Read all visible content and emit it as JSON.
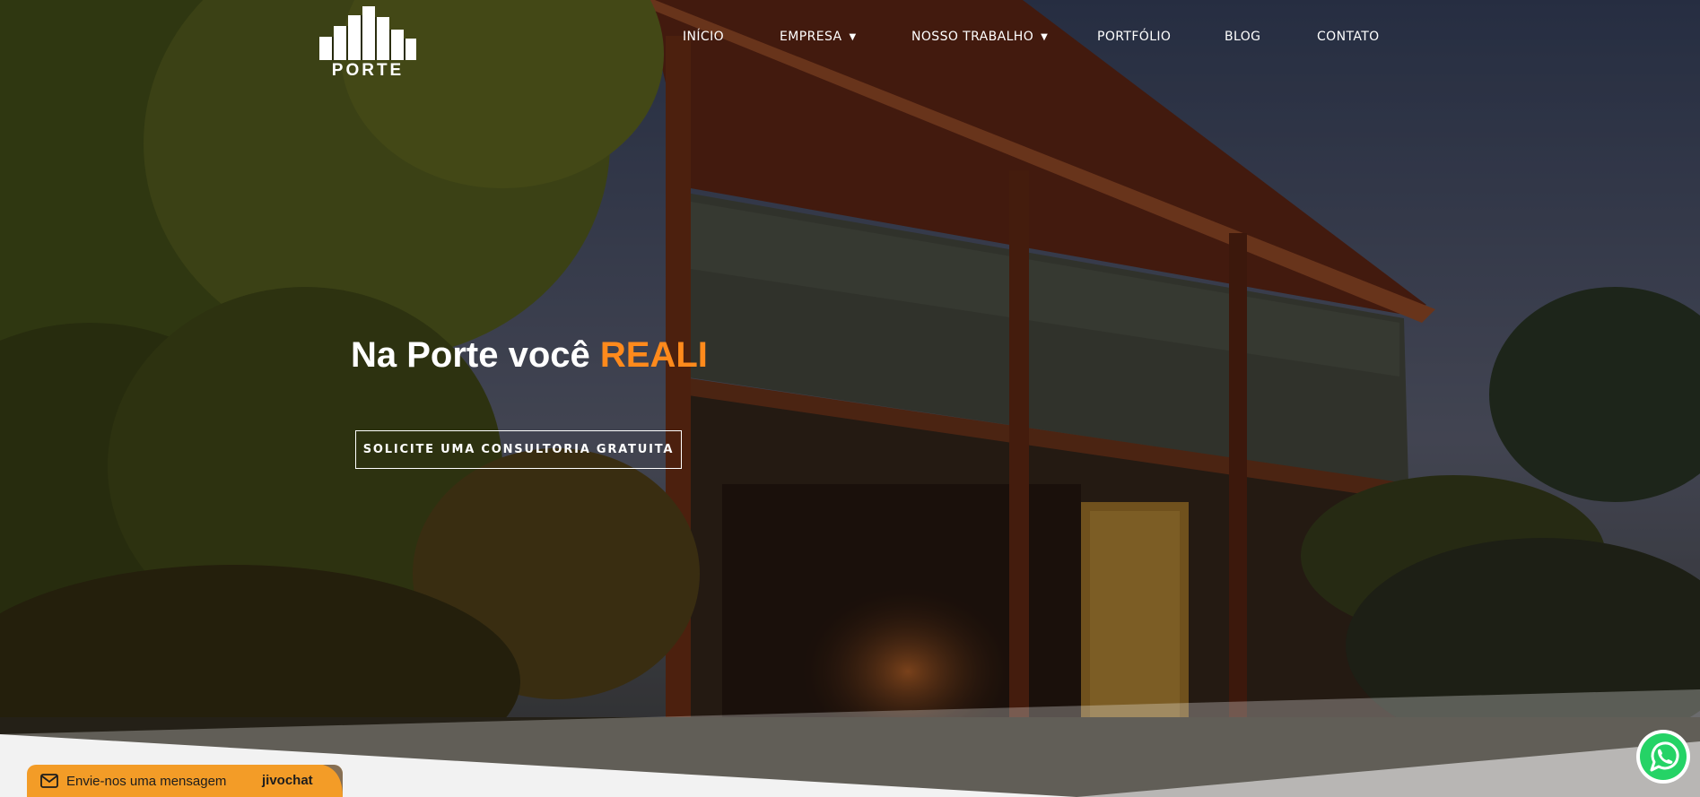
{
  "brand": {
    "logo_text": "PORTE"
  },
  "nav": {
    "items": [
      {
        "label": "INÍCIO",
        "dropdown": false
      },
      {
        "label": "EMPRESA",
        "dropdown": true
      },
      {
        "label": "NOSSO TRABALHO",
        "dropdown": true
      },
      {
        "label": "PORTFÓLIO",
        "dropdown": false
      },
      {
        "label": "BLOG",
        "dropdown": false
      },
      {
        "label": "CONTATO",
        "dropdown": false
      }
    ]
  },
  "hero": {
    "headline_prefix": "Na Porte você ",
    "headline_accent": "REALI",
    "cta_label": "SOLICITE UMA CONSULTORIA GRATUITA"
  },
  "chat": {
    "message_label": "Envie-nos uma mensagem",
    "brand": "jivochat",
    "icon": "mail-icon"
  },
  "whatsapp": {
    "icon": "whatsapp-icon"
  },
  "colors": {
    "accent": "#ff8a1c",
    "chat_bg": "#f39c27",
    "whatsapp": "#25d366"
  }
}
